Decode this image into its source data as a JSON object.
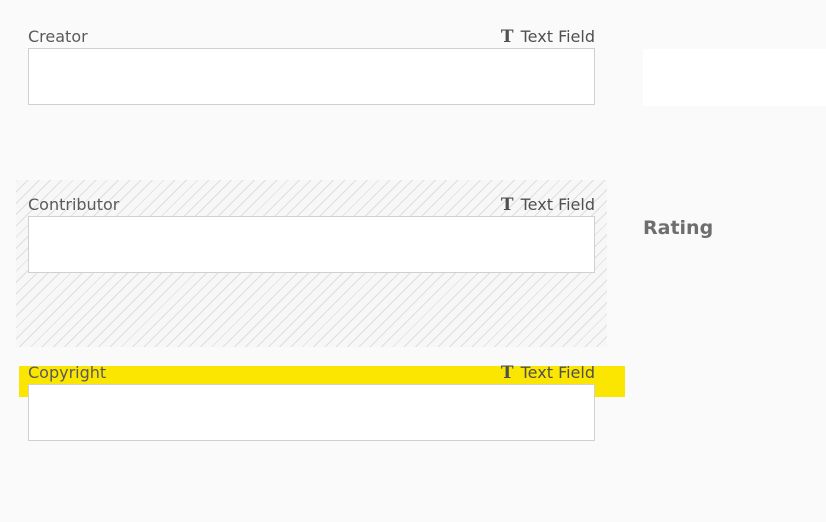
{
  "fields": [
    {
      "label": "Creator",
      "type_icon": "T",
      "type_label": "Text Field",
      "value": ""
    },
    {
      "label": "Contributor",
      "type_icon": "T",
      "type_label": "Text Field",
      "value": ""
    },
    {
      "label": "Copyright",
      "type_icon": "T",
      "type_label": "Text Field",
      "value": ""
    }
  ],
  "right_panel": {
    "rating_label": "Rating"
  },
  "colors": {
    "background": "#fafafa",
    "highlight": "#fae600",
    "input_border": "#d0d0d0",
    "drop_zone_hatch": "#dedede"
  }
}
